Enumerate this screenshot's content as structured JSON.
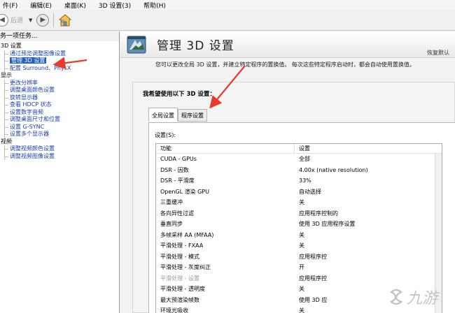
{
  "menu": {
    "items": [
      "件(F)",
      "编辑(E)",
      "桌面(K)",
      "3D 设置(3)",
      "帮助(H)"
    ]
  },
  "toolbar": {
    "back_label": "后退"
  },
  "left": {
    "task_header": "务一项任务...",
    "tree": [
      {
        "type": "cat",
        "label": "3D 设置"
      },
      {
        "type": "item",
        "label": "通过预览调整图像设置"
      },
      {
        "type": "item",
        "label": "管理 3D 设置",
        "selected": true
      },
      {
        "type": "item",
        "label": "配置 Surround、PhysX"
      },
      {
        "type": "cat",
        "label": "显示"
      },
      {
        "type": "item",
        "label": "更改分辨率"
      },
      {
        "type": "item",
        "label": "调整桌面颜色设置"
      },
      {
        "type": "item",
        "label": "旋转显示器"
      },
      {
        "type": "item",
        "label": "查看 HDCP 状态"
      },
      {
        "type": "item",
        "label": "设置数字音频"
      },
      {
        "type": "item",
        "label": "调整桌面尺寸和位置"
      },
      {
        "type": "item",
        "label": "设置 G-SYNC"
      },
      {
        "type": "item",
        "label": "设置多个显示器"
      },
      {
        "type": "cat",
        "label": "视频"
      },
      {
        "type": "item",
        "label": "调整视频颜色设置"
      },
      {
        "type": "item",
        "label": "调整视频图像设置"
      }
    ]
  },
  "right": {
    "title": "管理 3D 设置",
    "restore_defaults": "恢复默认",
    "description": "您可以更改全局 3D 设置，并建立特定程序的置换值。 每次这些特定程序启动时，都会自动使用置换值。",
    "group_title": "我希望使用以下 3D 设置：",
    "tabs": [
      "全局设置",
      "程序设置"
    ],
    "settings_label": "设置(S):",
    "columns": [
      "功能",
      "设置"
    ],
    "rows": [
      {
        "feature": "CUDA - GPUs",
        "value": "全部"
      },
      {
        "feature": "DSR - 因数",
        "value": "4.00x (native resolution)"
      },
      {
        "feature": "DSR - 平滑度",
        "value": "33%"
      },
      {
        "feature": "OpenGL 渲染 GPU",
        "value": "自动选择"
      },
      {
        "feature": "三重缓冲",
        "value": "关"
      },
      {
        "feature": "各向异性过滤",
        "value": "应用程序控制的"
      },
      {
        "feature": "垂直同步",
        "value": "使用 3D 应用程序设置"
      },
      {
        "feature": "多帧采样 AA (MFAA)",
        "value": "关"
      },
      {
        "feature": "平滑处理 - FXAA",
        "value": "关"
      },
      {
        "feature": "平滑处理 - 模式",
        "value": "应用程序控"
      },
      {
        "feature": "平滑处理 - 灰度纠正",
        "value": "开"
      },
      {
        "feature": "平滑处理 - 设置",
        "value": "应用程序控",
        "dim": true
      },
      {
        "feature": "平滑处理 - 透明度",
        "value": "关"
      },
      {
        "feature": "最大预渲染帧数",
        "value": "使用 3D 应"
      },
      {
        "feature": "环境光吸收",
        "value": "关"
      }
    ]
  },
  "watermark": {
    "text": "九游"
  },
  "colors": {
    "selection": "#1f5fbf",
    "link": "#1a3fa8",
    "arrow": "#e8392b"
  }
}
